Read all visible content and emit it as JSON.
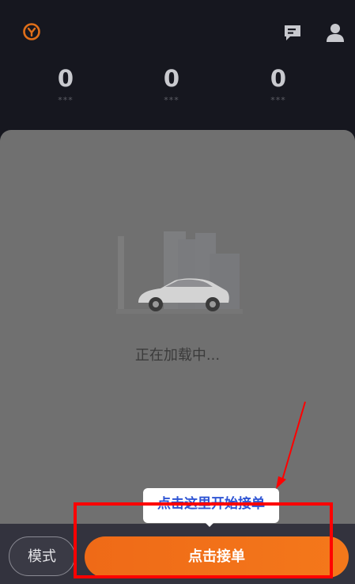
{
  "header": {
    "icons": [
      "logo-icon",
      "message-icon",
      "user-icon"
    ],
    "stats": [
      {
        "value": "0",
        "label": "***"
      },
      {
        "value": "0",
        "label": "***"
      },
      {
        "value": "0",
        "label": "***"
      }
    ]
  },
  "main": {
    "loading_text": "正在加载中..."
  },
  "tooltip": {
    "text": "点击这里开始接单"
  },
  "footer": {
    "mode_label": "模式",
    "accept_label": "点击接单"
  },
  "colors": {
    "accent": "#f4781b",
    "highlight": "#ff0000",
    "tip_text": "#2f55d4"
  }
}
